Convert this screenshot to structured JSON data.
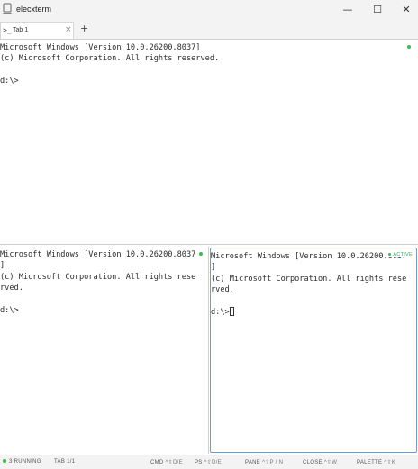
{
  "window": {
    "title": "elecxterm",
    "minimize": "—",
    "maximize": "☐",
    "close": "✕"
  },
  "tabs": [
    {
      "icon": ">_",
      "label": "Tab 1",
      "close": "×"
    }
  ],
  "new_tab": "+",
  "panes": {
    "top": {
      "lines": "Microsoft Windows [Version 10.0.26200.8037]\n(c) Microsoft Corporation. All rights reserved.\n\nd:\\>"
    },
    "bottom_left": {
      "lines": "Microsoft Windows [Version 10.0.26200.8037\n]\n(c) Microsoft Corporation. All rights rese\nrved.\n\nd:\\>"
    },
    "bottom_right": {
      "lines": "Microsoft Windows [Version 10.0.26200.8037\n]\n(c) Microsoft Corporation. All rights rese\nrved.\n\nd:\\>",
      "badge": "ACTIVE"
    }
  },
  "statusbar": {
    "running": "3 RUNNING",
    "tab": "TAB 1/1",
    "cmd_label": "CMD",
    "cmd_key": "^⇧D/E",
    "ps_label": "PS",
    "ps_key": "^⇧D/E",
    "pane_label": "PANE",
    "pane_key": "^⇧P / N",
    "close_label": "CLOSE",
    "close_key": "^⇧W",
    "palette_label": "PALETTE",
    "palette_key": "^⇧K"
  },
  "colors": {
    "status_green": "#3fb950",
    "active_border": "#7a9ab8"
  }
}
